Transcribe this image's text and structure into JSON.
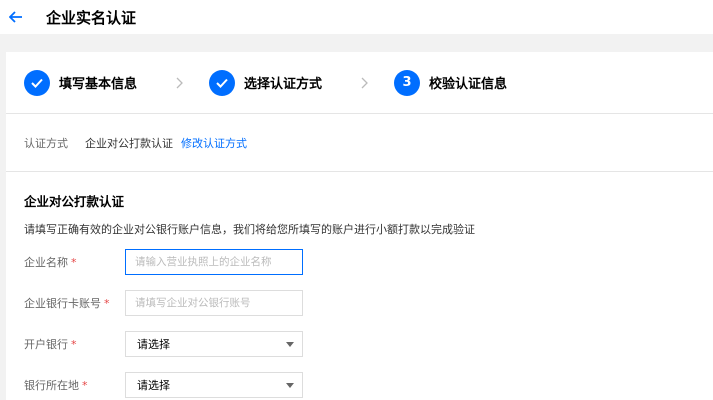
{
  "header": {
    "title": "企业实名认证"
  },
  "steps": [
    {
      "label": "填写基本信息",
      "status": "done"
    },
    {
      "label": "选择认证方式",
      "status": "done"
    },
    {
      "number": "3",
      "label": "校验认证信息",
      "status": "current"
    }
  ],
  "method": {
    "label": "认证方式",
    "value": "企业对公打款认证",
    "link": "修改认证方式"
  },
  "section": {
    "title": "企业对公打款认证",
    "description": "请填写正确有效的企业对公银行账户信息，我们将给您所填写的账户进行小额打款以完成验证"
  },
  "form": {
    "company_name": {
      "label": "企业名称",
      "required_mark": "*",
      "placeholder": "请输入营业执照上的企业名称",
      "value": ""
    },
    "bank_account": {
      "label": "企业银行卡账号",
      "required_mark": "*",
      "placeholder": "请填写企业对公银行账号",
      "value": ""
    },
    "bank": {
      "label": "开户银行",
      "required_mark": "*",
      "value": "请选择"
    },
    "bank_location": {
      "label": "银行所在地",
      "required_mark": "*",
      "value": "请选择"
    }
  },
  "colors": {
    "accent": "#006eff",
    "required": "#e54545"
  }
}
